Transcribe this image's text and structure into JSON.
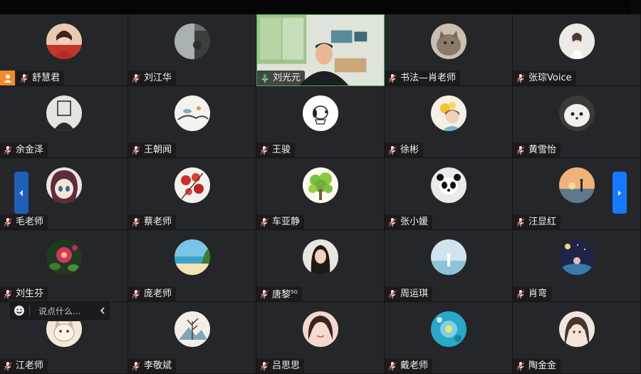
{
  "participants": [
    {
      "name": "舒慧君",
      "avatar": "woman-red-dress",
      "host": true
    },
    {
      "name": "刘江华",
      "avatar": "evening-window"
    },
    {
      "name": "刘光元",
      "avatar": "live-video",
      "video": true,
      "mic": "active"
    },
    {
      "name": "书法—肖老师",
      "avatar": "cat"
    },
    {
      "name": "张琮Voice",
      "avatar": "woman-white-dress"
    },
    {
      "name": "余金泽",
      "avatar": "cartoon-sketch"
    },
    {
      "name": "王朝闻",
      "avatar": "ink-painting"
    },
    {
      "name": "王骏",
      "avatar": "snoopy"
    },
    {
      "name": "徐彬",
      "avatar": "girl-flowers"
    },
    {
      "name": "黄雪怡",
      "avatar": "white-puppy"
    },
    {
      "name": "毛老师",
      "avatar": "anime-girl"
    },
    {
      "name": "蔡老师",
      "avatar": "red-flowers"
    },
    {
      "name": "车亚静",
      "avatar": "green-tree"
    },
    {
      "name": "张小媛",
      "avatar": "panda"
    },
    {
      "name": "汪显红",
      "avatar": "sunset-silhouette"
    },
    {
      "name": "刘生芬",
      "avatar": "pink-flower"
    },
    {
      "name": "庞老师",
      "avatar": "beach"
    },
    {
      "name": "唐黎",
      "name_suffix": "5G",
      "avatar": "woman-portrait"
    },
    {
      "name": "周运琪",
      "avatar": "seaside-figure"
    },
    {
      "name": "肖弯",
      "avatar": "starry-night"
    },
    {
      "name": "江老师",
      "avatar": "cartoon-cat"
    },
    {
      "name": "李敬斌",
      "avatar": "tree-drawing"
    },
    {
      "name": "吕思思",
      "avatar": "smiling-girl"
    },
    {
      "name": "戴老师",
      "avatar": "blue-flower"
    },
    {
      "name": "陶金金",
      "avatar": "anime-portrait"
    }
  ],
  "chat": {
    "placeholder": "说点什么..."
  },
  "icons": {
    "mic_muted": "mic-muted-icon",
    "mic_active": "mic-active-icon",
    "host": "host-person-icon",
    "prev": "chevron-left-icon",
    "next": "chevron-right-icon",
    "emoji": "emoji-icon",
    "collapse": "chevron-left-icon"
  },
  "colors": {
    "accent": "#1677ff",
    "host_badge": "#f08b2c",
    "mic_muted": "#e23c3c",
    "mic_active": "#3fae57",
    "tile_bg": "#252629"
  }
}
